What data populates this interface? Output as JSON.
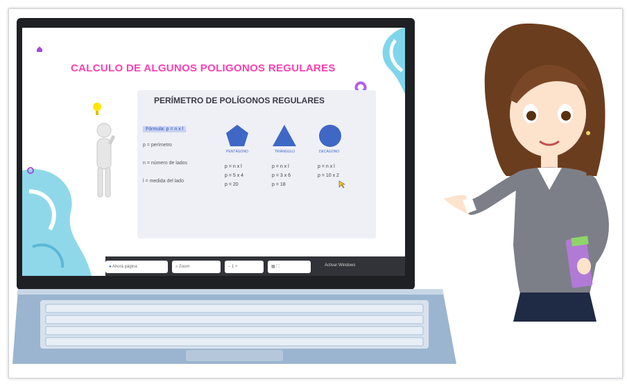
{
  "slide": {
    "title": "CALCULO DE ALGUNOS POLIGONOS REGULARES",
    "panel_title": "PERÍMETRO DE POLÍGONOS REGULARES",
    "formula_highlight": "Fórmula: p = n x l",
    "legend": [
      "p = perímetro",
      "n = número de lados",
      "l = medida del lado"
    ],
    "shapes": [
      {
        "name": "pentagon-icon",
        "caption": "PENTÁGONO",
        "formulas": [
          "p = n x l",
          "p = 5 x 4",
          "p = 20"
        ]
      },
      {
        "name": "triangle-icon",
        "caption": "TRIÁNGULO",
        "formulas": [
          "p = n x l",
          "p = 3 x 6",
          "p = 18"
        ]
      },
      {
        "name": "circle-icon",
        "caption": "DECÁGONO",
        "formulas": [
          "p = n x l",
          "p = 10 x 2",
          ""
        ]
      }
    ]
  },
  "toolbar": {
    "page_label": "Ahorá página",
    "zoom_label": "Zoom",
    "page_number": "1",
    "activate_text": "Activar Windows"
  },
  "colors": {
    "title": "#ff3fb0",
    "shape_blue": "#3e67c6",
    "accent_purple": "#a24dd6"
  }
}
